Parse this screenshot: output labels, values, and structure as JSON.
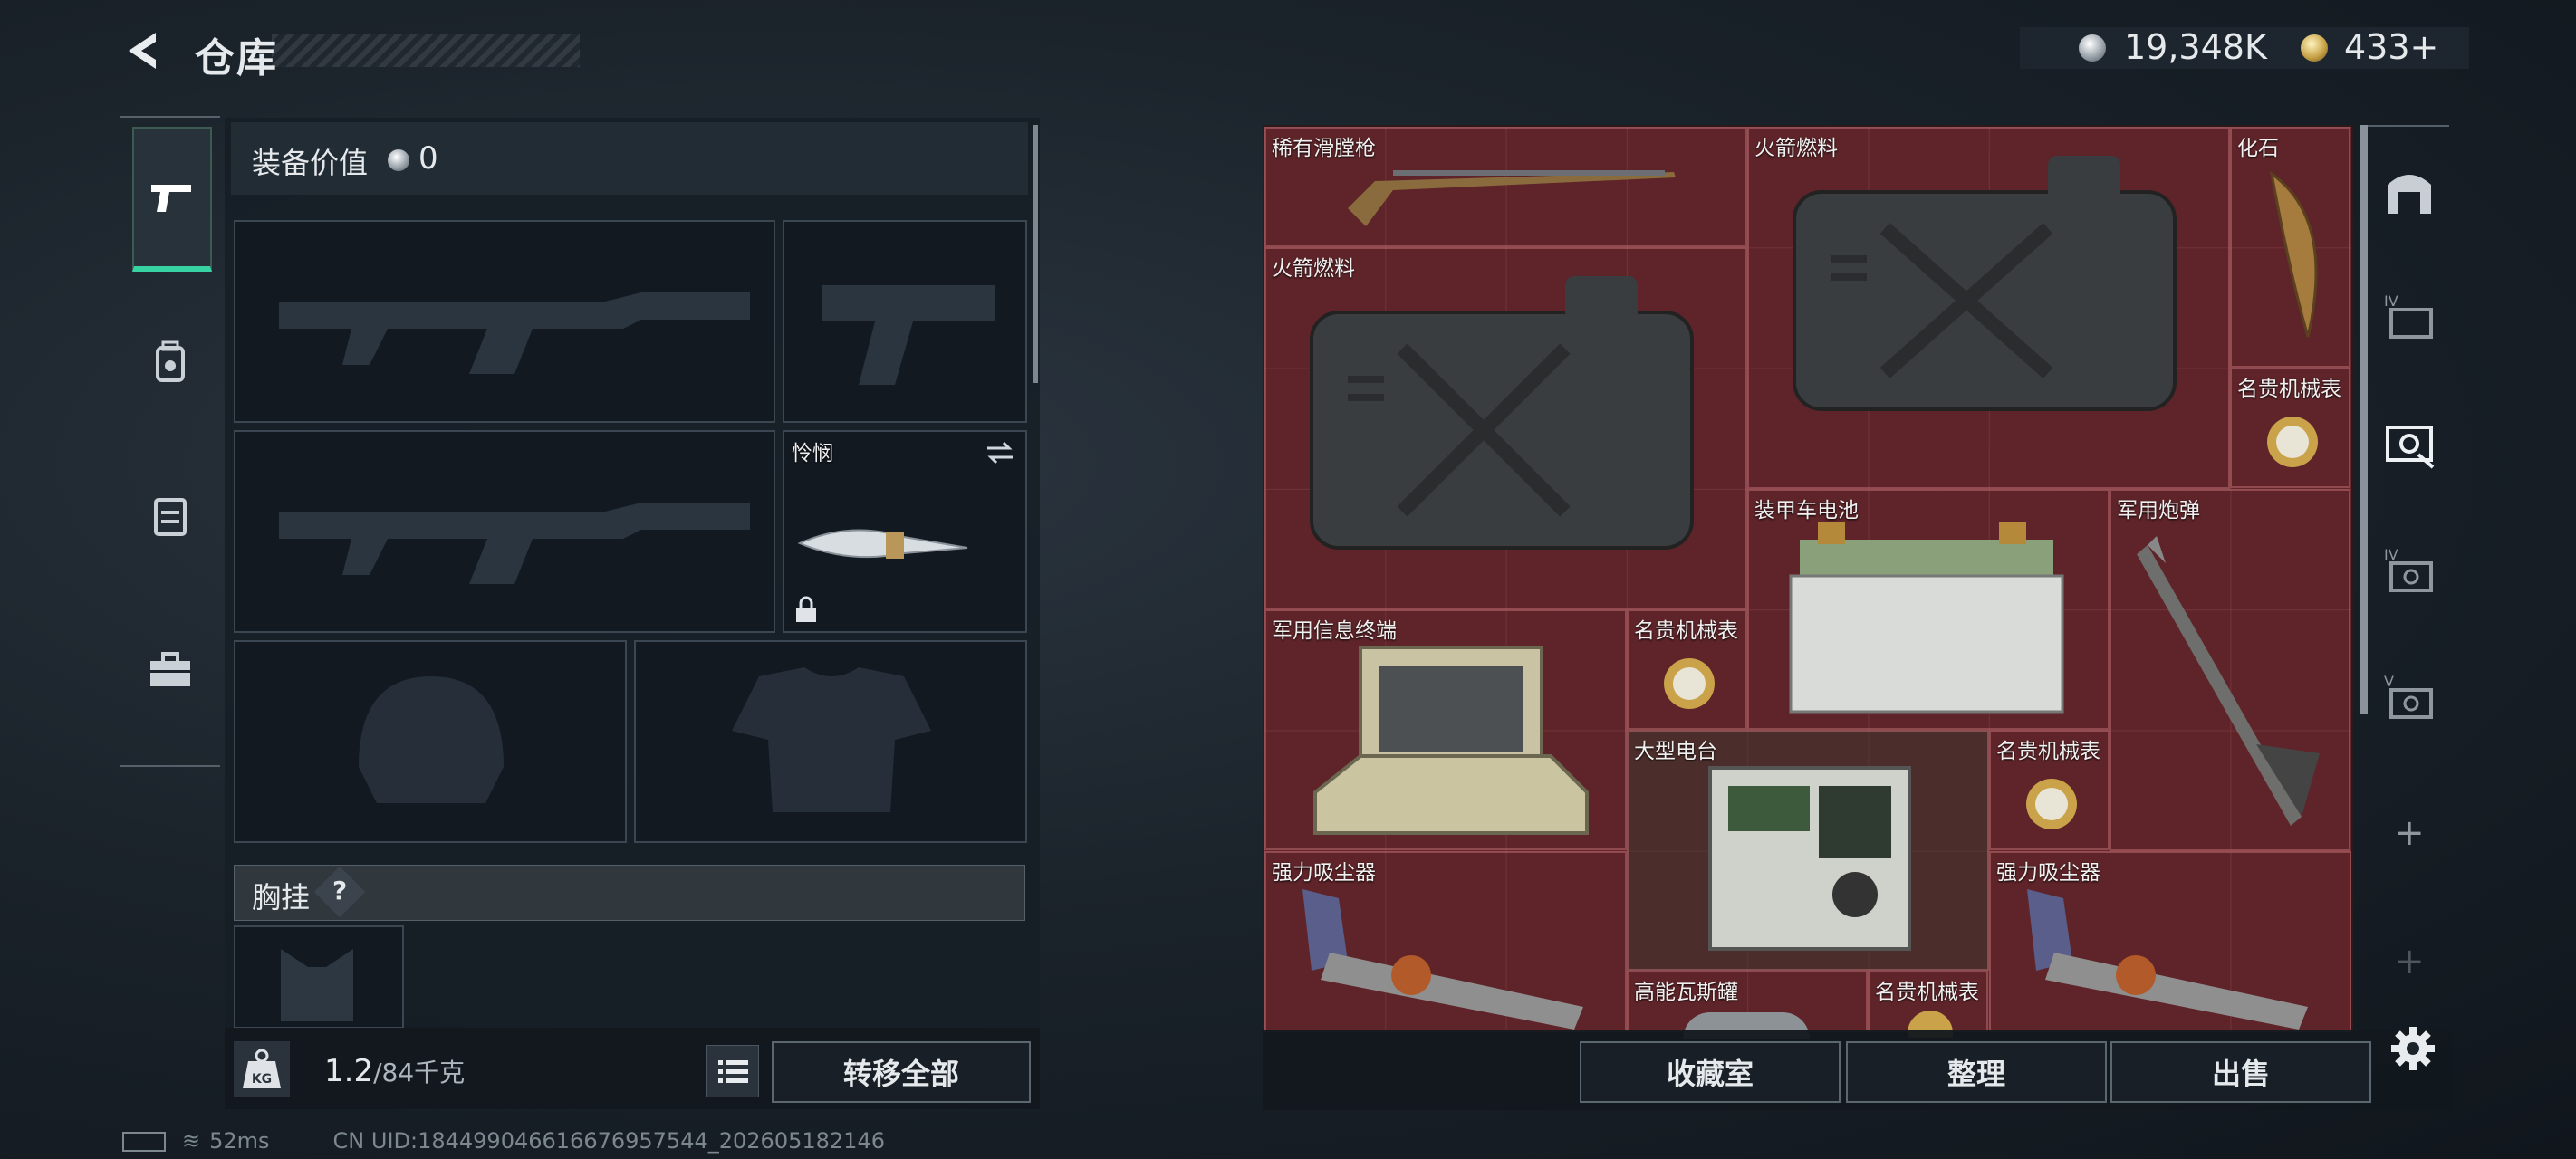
{
  "header": {
    "title": "仓库",
    "back_icon": "back-arrow-icon"
  },
  "currency": {
    "silver": "19,348K",
    "gold": "433+"
  },
  "loadout": {
    "equip_value_label": "装备价值",
    "equip_value": "0",
    "melee_name": "怜悯",
    "chest_label": "胸挂",
    "chest_help": "?",
    "weight_current": "1.2",
    "weight_max": "/84千克",
    "transfer_all": "转移全部"
  },
  "status": {
    "ping": "52ms",
    "uid": "CN UID:1844990466166769575​44_202605182146"
  },
  "storage": {
    "items": [
      {
        "name": "稀有滑膛枪"
      },
      {
        "name": "火箭燃料"
      },
      {
        "name": "化石"
      },
      {
        "name": "火箭燃料"
      },
      {
        "name": "名贵机械表"
      },
      {
        "name": "装甲车电池"
      },
      {
        "name": "军用炮弹"
      },
      {
        "name": "军用信息终端"
      },
      {
        "name": "名贵机械表"
      },
      {
        "name": "大型电台"
      },
      {
        "name": "名贵机械表"
      },
      {
        "name": "强力吸尘器"
      },
      {
        "name": "强力吸尘器"
      },
      {
        "name": "高能瓦斯罐"
      },
      {
        "name": "名贵机械表"
      }
    ],
    "buttons": {
      "collection": "收藏室",
      "organize": "整理",
      "sell": "出售"
    }
  },
  "colors": {
    "accent": "#37d3a2",
    "storage_bg": "#5e2429"
  }
}
